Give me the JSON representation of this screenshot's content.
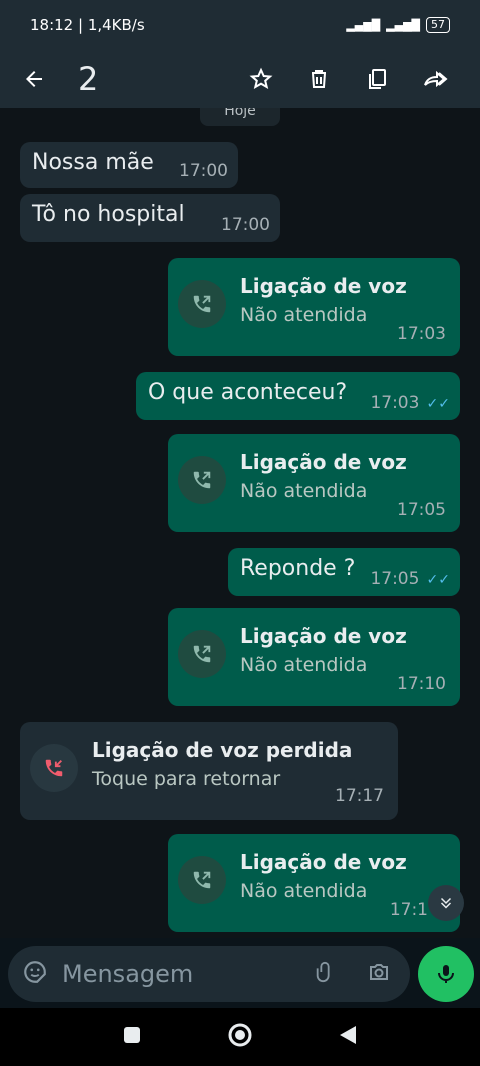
{
  "status_bar": {
    "time_speed": "18:12 | 1,4KB/s",
    "battery": "57"
  },
  "toolbar": {
    "selected_count": "2"
  },
  "chat": {
    "day_chip": "Hoje",
    "messages": [
      {
        "type": "text",
        "direction": "in",
        "text": "Nossa mãe",
        "time": "17:00"
      },
      {
        "type": "text",
        "direction": "in",
        "text": "Tô no hospital",
        "time": "17:00"
      },
      {
        "type": "call",
        "direction": "out",
        "title": "Ligação de voz",
        "subtitle": "Não atendida",
        "time": "17:03"
      },
      {
        "type": "text",
        "direction": "out",
        "text": "O que aconteceu?",
        "time": "17:03"
      },
      {
        "type": "call",
        "direction": "out",
        "title": "Ligação de voz",
        "subtitle": "Não atendida",
        "time": "17:05"
      },
      {
        "type": "text",
        "direction": "out",
        "text": "Reponde ?",
        "time": "17:05"
      },
      {
        "type": "call",
        "direction": "out",
        "title": "Ligação de voz",
        "subtitle": "Não atendida",
        "time": "17:10"
      },
      {
        "type": "missed_call",
        "direction": "in",
        "title": "Ligação de voz perdida",
        "subtitle": "Toque para retornar",
        "time": "17:17"
      },
      {
        "type": "call",
        "direction": "out",
        "title": "Ligação de voz",
        "subtitle": "Não atendida",
        "time": "17:1"
      }
    ]
  },
  "composer": {
    "placeholder": "Mensagem"
  },
  "colors": {
    "header": "#1f2c34",
    "outgoing": "#005c4b",
    "incoming": "#1f2c34",
    "mic": "#21c063",
    "read_ticks": "#53bdeb",
    "missed_call": "#f15c6d"
  }
}
